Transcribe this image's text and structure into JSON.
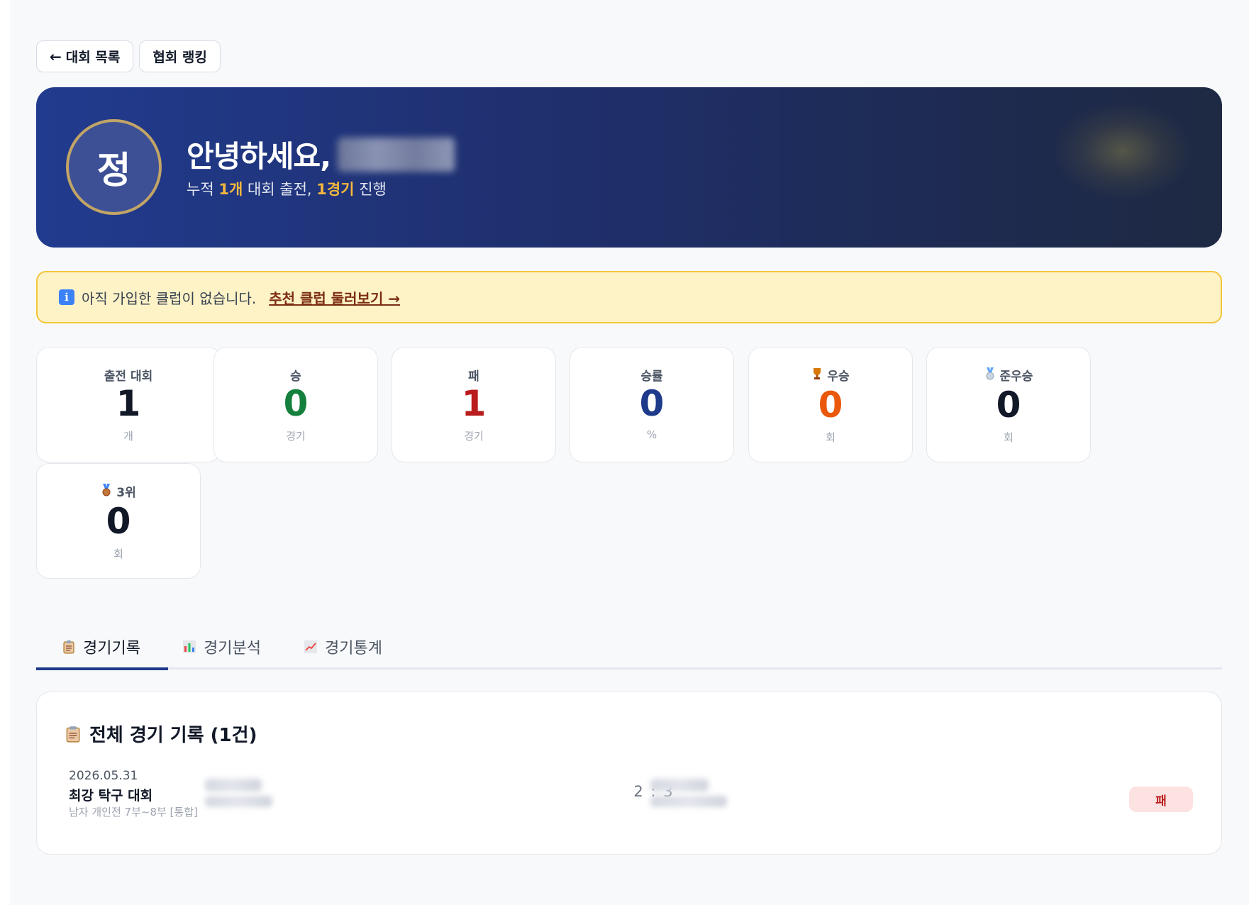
{
  "nav": {
    "back_label": "대회 목록",
    "ranking_label": "협회 랭킹"
  },
  "hero": {
    "avatar_char": "정",
    "greeting": "안녕하세요,",
    "sub_prefix": "누적 ",
    "tournaments_count": "1개",
    "sub_middle": " 대회 출전, ",
    "matches_count": "1경기",
    "sub_suffix": " 진행"
  },
  "notice": {
    "text": "아직 가입한 클럽이 없습니다.",
    "link_label": "추천 클럽 둘러보기 →"
  },
  "stats": [
    {
      "label": "출전 대회",
      "value": "1",
      "unit": "개",
      "color": "#111827"
    },
    {
      "label": "승",
      "value": "0",
      "unit": "경기",
      "color": "#15803d"
    },
    {
      "label": "패",
      "value": "1",
      "unit": "경기",
      "color": "#b91c1c"
    },
    {
      "label": "승률",
      "value": "0",
      "unit": "%",
      "color": "#1e3a8a"
    },
    {
      "label": "우승",
      "value": "0",
      "unit": "회",
      "color": "#ea580c",
      "icon": "trophy-icon"
    },
    {
      "label": "준우승",
      "value": "0",
      "unit": "회",
      "color": "#111827",
      "icon": "silver-medal-icon"
    },
    {
      "label": "3위",
      "value": "0",
      "unit": "회",
      "color": "#111827",
      "icon": "bronze-medal-icon"
    }
  ],
  "tabs": [
    {
      "label": "경기기록",
      "icon": "clipboard-icon",
      "active": true
    },
    {
      "label": "경기분석",
      "icon": "bar-chart-icon",
      "active": false
    },
    {
      "label": "경기통계",
      "icon": "line-chart-icon",
      "active": false
    }
  ],
  "records": {
    "title": "전체 경기 기록 (1건)",
    "rows": [
      {
        "date": "2026.05.31",
        "tournament": "최강 탁구 대회",
        "category": "남자 개인전 7부~8부 [통합]",
        "score": "2 : 3",
        "result": "패"
      }
    ]
  },
  "colors": {
    "primary": "#1e3a8a",
    "accent_gold": "#f5b83d",
    "notice_bg": "#fef3c7",
    "notice_border": "#f3c53a",
    "lose": "#b91c1c"
  }
}
